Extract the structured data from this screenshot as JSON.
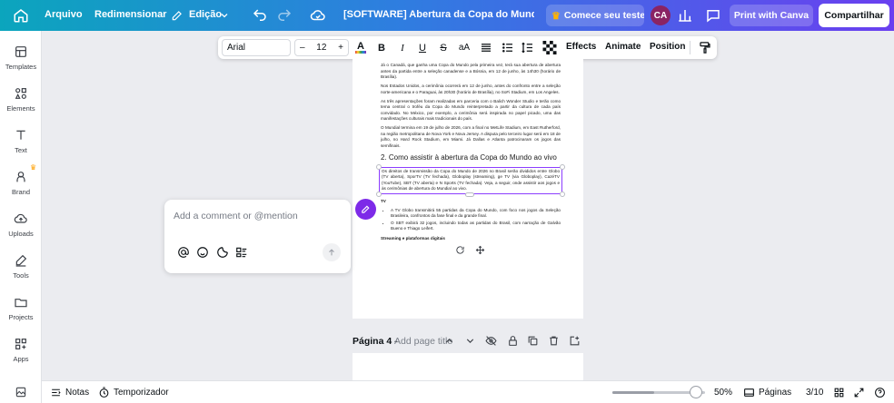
{
  "topbar": {
    "menu_file": "Arquivo",
    "menu_resize": "Redimensionar",
    "menu_edit": "Edição",
    "doc_title": "[SOFTWARE] Abertura da Copa do Mundo hoje",
    "trial_label": "Comece seu teste",
    "avatar_initials": "CA",
    "print_label": "Print with Canva",
    "share_label": "Compartilhar"
  },
  "sidebar": {
    "items": [
      {
        "label": "Templates",
        "icon": "templates-icon"
      },
      {
        "label": "Elements",
        "icon": "elements-icon"
      },
      {
        "label": "Text",
        "icon": "text-icon"
      },
      {
        "label": "Brand",
        "icon": "brand-icon"
      },
      {
        "label": "Uploads",
        "icon": "uploads-icon"
      },
      {
        "label": "Tools",
        "icon": "tools-icon"
      },
      {
        "label": "Projects",
        "icon": "projects-icon"
      },
      {
        "label": "Apps",
        "icon": "apps-icon"
      }
    ]
  },
  "text_toolbar": {
    "font": "Arial",
    "size": "12",
    "minus": "–",
    "plus": "+",
    "effects": "Effects",
    "animate": "Animate",
    "position": "Position"
  },
  "document": {
    "p1": "Já o Canadá, que ganha uma Copa do Mundo pela primeira vez, terá sua abertura de abertura antes da partida entre a seleção canadense e a Bósnia, em 12 de junho, às 14h30 (horário de Brasília).",
    "p2": "Nos Estados Unidos, a cerimônia ocorrerá em 12 de junho, antes do confronto entre a seleção norte-americana e o Paraguai, às 20h30 (horário de Brasília), no SoFi Stadium, em Los Angeles.",
    "p3": "As três apresentações foram realizadas em parceria com o Balich Wonder Studio e terão como tema central o troféu da Copa do Mundo reinterpretado a partir da cultura de cada país convidado. No México, por exemplo, a cerimônia será inspirada no papel picado, uma das manifestações culturais mais tradicionais do país.",
    "p4": "O Mundial termina em 19 de julho de 2026, com a final no MetLife Stadium, em East Rutherford, na região metropolitana de Nova York e Nova Jersey. A disputa pelo terceiro lugar será em 18 de julho, no Hard Rock Stadium, em Miami. Já Dallas e Atlanta patrocinaram os jogos das semifinais.",
    "heading": "2. Como assistir à abertura da Copa do Mundo ao vivo",
    "p5": "Os direitos de transmissão da Copa do Mundo de 2026 no Brasil serão divididos entre Globo (TV aberta), SporTV (TV fechada), Globoplay (streaming), ge TV (via Globoplay), CazéTV (YouTube), SBT (TV aberta) e N Sports (TV fechada). Veja, a seguir, onde assistir aos jogos e às cerimônias de abertura do Mundial ao vivo.",
    "tv_label": "TV",
    "bullet1": "A TV Globo transmitirá 55 partidas da Copa do Mundo, com foco nos jogos da Seleção Brasileira, confrontos da fase final e da grande final.",
    "bullet2": "O SBT exibirá 32 jogos, incluindo todas as partidas do Brasil, com narração de Galvão Bueno e Thiago Leifert.",
    "streaming_label": "Streaming e plataformas digitais"
  },
  "comment": {
    "placeholder": "Add a comment or @mention"
  },
  "page4": {
    "label": "Página 4",
    "separator": "-",
    "add_title": "Add page title"
  },
  "bottombar": {
    "notes": "Notas",
    "timer": "Temporizador",
    "zoom": "50%",
    "zoom_fraction": 0.45,
    "pages": "Páginas",
    "page_counter": "3/10"
  },
  "colors": {
    "accent": "#8b3dff",
    "topbar_start": "#0ba5bd",
    "topbar_end": "#6a3ff0"
  }
}
